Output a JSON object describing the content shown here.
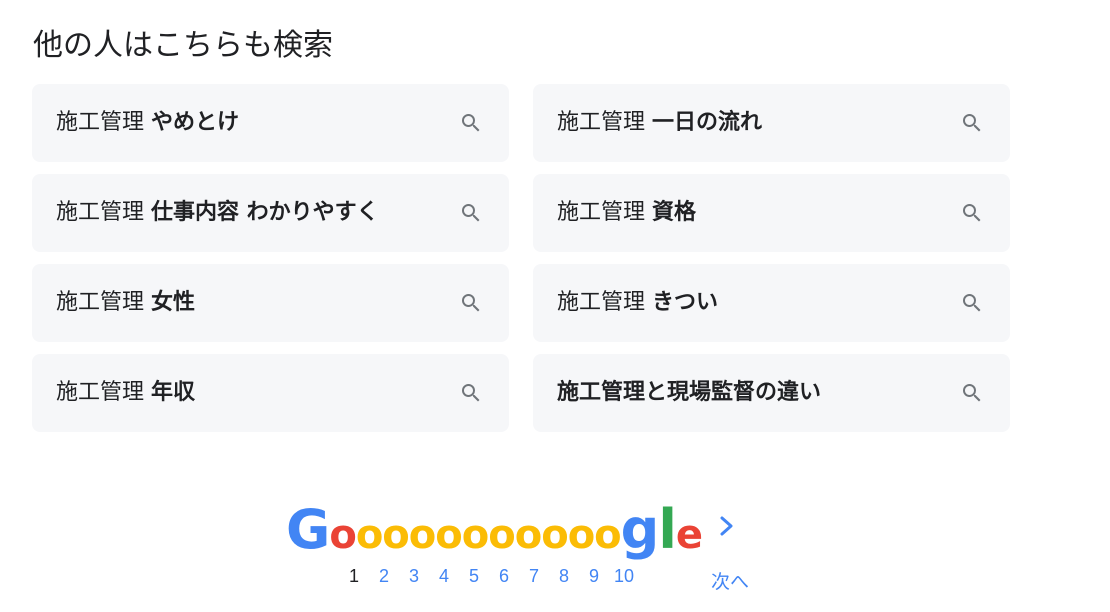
{
  "section": {
    "title": "他の人はこちらも検索"
  },
  "related_searches": [
    {
      "prefix": "施工管理 ",
      "suffix": "やめとけ",
      "full": ""
    },
    {
      "prefix": "施工管理 ",
      "suffix": "一日の流れ",
      "full": ""
    },
    {
      "prefix": "施工管理 ",
      "suffix": "仕事内容 わかりやすく",
      "full": ""
    },
    {
      "prefix": "施工管理 ",
      "suffix": "資格",
      "full": ""
    },
    {
      "prefix": "施工管理 ",
      "suffix": "女性",
      "full": ""
    },
    {
      "prefix": "施工管理 ",
      "suffix": "きつい",
      "full": ""
    },
    {
      "prefix": "施工管理 ",
      "suffix": "年収",
      "full": ""
    },
    {
      "prefix": "",
      "suffix": "",
      "full": "施工管理と現場監督の違い"
    }
  ],
  "pagination": {
    "logo_letters": {
      "G": "G",
      "o_count": 11,
      "o": "o",
      "g": "g",
      "l": "l",
      "e": "e"
    },
    "pages": [
      "1",
      "2",
      "3",
      "4",
      "5",
      "6",
      "7",
      "8",
      "9",
      "10"
    ],
    "current_page": "1",
    "next_label": "次へ"
  },
  "icons": {
    "search": "search-icon",
    "next": "chevron-right-icon"
  },
  "colors": {
    "chip_bg": "#f6f7f9",
    "icon": "#70757a",
    "link": "#4285f4",
    "google_blue": "#4285f4",
    "google_red": "#ea4335",
    "google_yellow": "#fbbc05",
    "google_green": "#34a853"
  }
}
